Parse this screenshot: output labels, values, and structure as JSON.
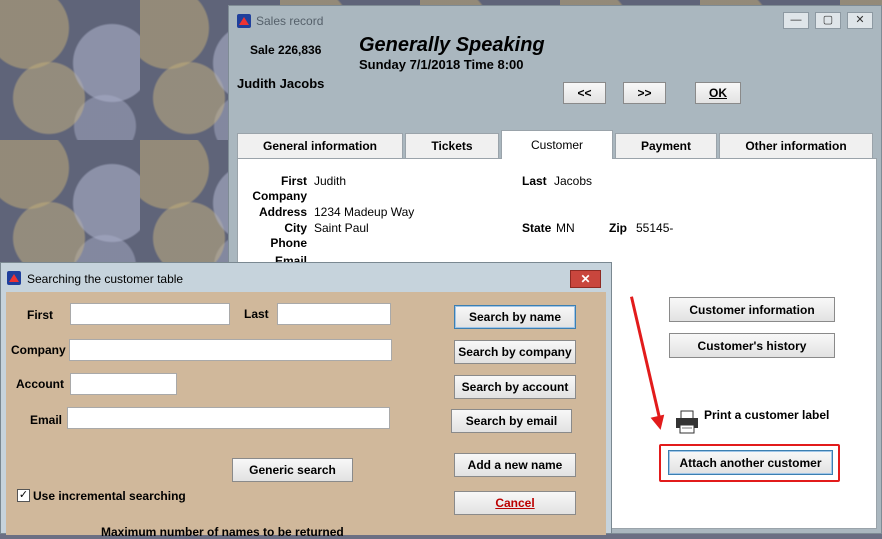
{
  "main_window": {
    "title": "Sales record",
    "sale_number": "Sale 226,836",
    "event_name": "Generally Speaking",
    "event_datetime": "Sunday 7/1/2018  Time 8:00",
    "customer_name": "Judith Jacobs",
    "buttons": {
      "prev": "<<",
      "next": ">>",
      "ok": "OK"
    },
    "window_controls": {
      "minimize": "—",
      "maximize": "▢",
      "close": "✕"
    }
  },
  "tabs": [
    {
      "label": "General information"
    },
    {
      "label": "Tickets"
    },
    {
      "label": "Customer"
    },
    {
      "label": "Payment"
    },
    {
      "label": "Other information"
    }
  ],
  "customer": {
    "first_label": "First",
    "first_value": "Judith",
    "last_label": "Last",
    "last_value": "Jacobs",
    "company_label": "Company",
    "address_label": "Address",
    "address_value": "1234 Madeup Way",
    "city_label": "City",
    "city_value": "Saint Paul",
    "state_label": "State",
    "state_value": "MN",
    "zip_label": "Zip",
    "zip_value": "55145-",
    "phone_label": "Phone",
    "email_label": "Email",
    "customer_info_button": "Customer information",
    "history_button": "Customer's history",
    "print_label": "Print a customer label",
    "attach_button": "Attach another customer"
  },
  "search_dialog": {
    "title": "Searching the customer table",
    "close": "✕",
    "first_label": "First",
    "last_label": "Last",
    "company_label": "Company",
    "account_label": "Account",
    "email_label": "Email",
    "first_value": "",
    "last_value": "",
    "company_value": "",
    "account_value": "",
    "email_value": "",
    "search_name": "Search by name",
    "search_company": "Search by company",
    "search_account": "Search by account",
    "search_email": "Search by email",
    "generic_search": "Generic search",
    "add_name": "Add a new name",
    "cancel": "Cancel",
    "incremental_label": "Use incremental searching",
    "incremental_checked": true,
    "bottom_partial": "Maximum number of names to be returned"
  },
  "colors": {
    "highlight": "#e21b1b"
  }
}
